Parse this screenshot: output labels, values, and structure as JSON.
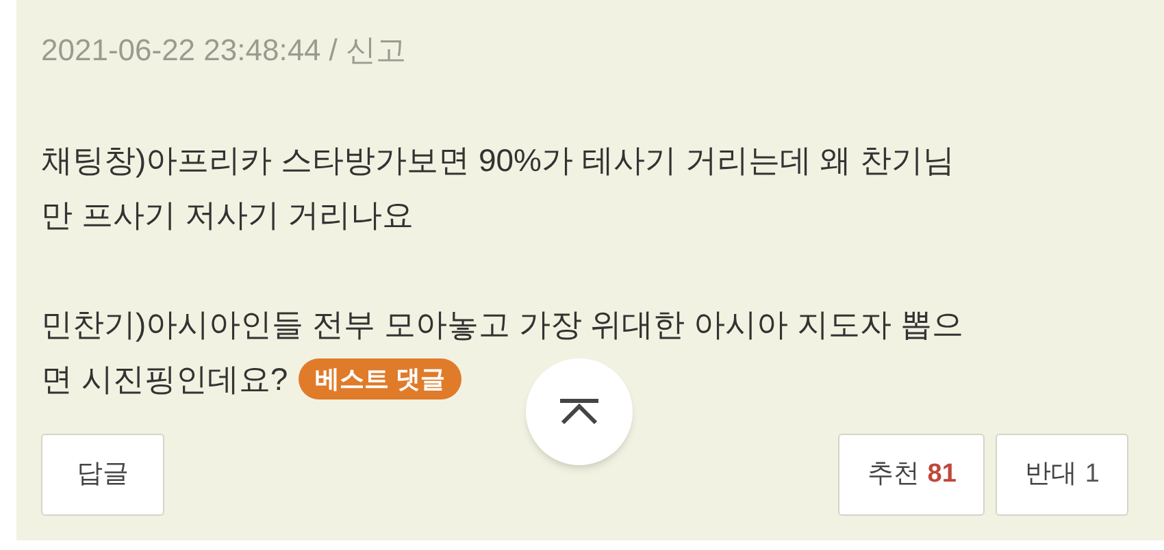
{
  "comment": {
    "timestamp": "2021-06-22 23:48:44",
    "separator": "/",
    "report_link": "신고",
    "paragraphs": [
      [
        "채팅창)아프리카 스타방가보면 90%가 테사기 거리는데 왜 찬기님",
        "만 프사기 저사기 거리나요"
      ],
      [
        "민찬기)아시아인들 전부 모아놓고 가장 위대한 아시아 지도자 뽑으",
        "면 시진핑인데요?"
      ]
    ],
    "badge": "베스트 댓글",
    "reply_button": "답글",
    "votes": [
      {
        "kind": "up",
        "label": "추천",
        "count": "81"
      },
      {
        "kind": "down",
        "label": "반대",
        "count": "1"
      }
    ]
  }
}
